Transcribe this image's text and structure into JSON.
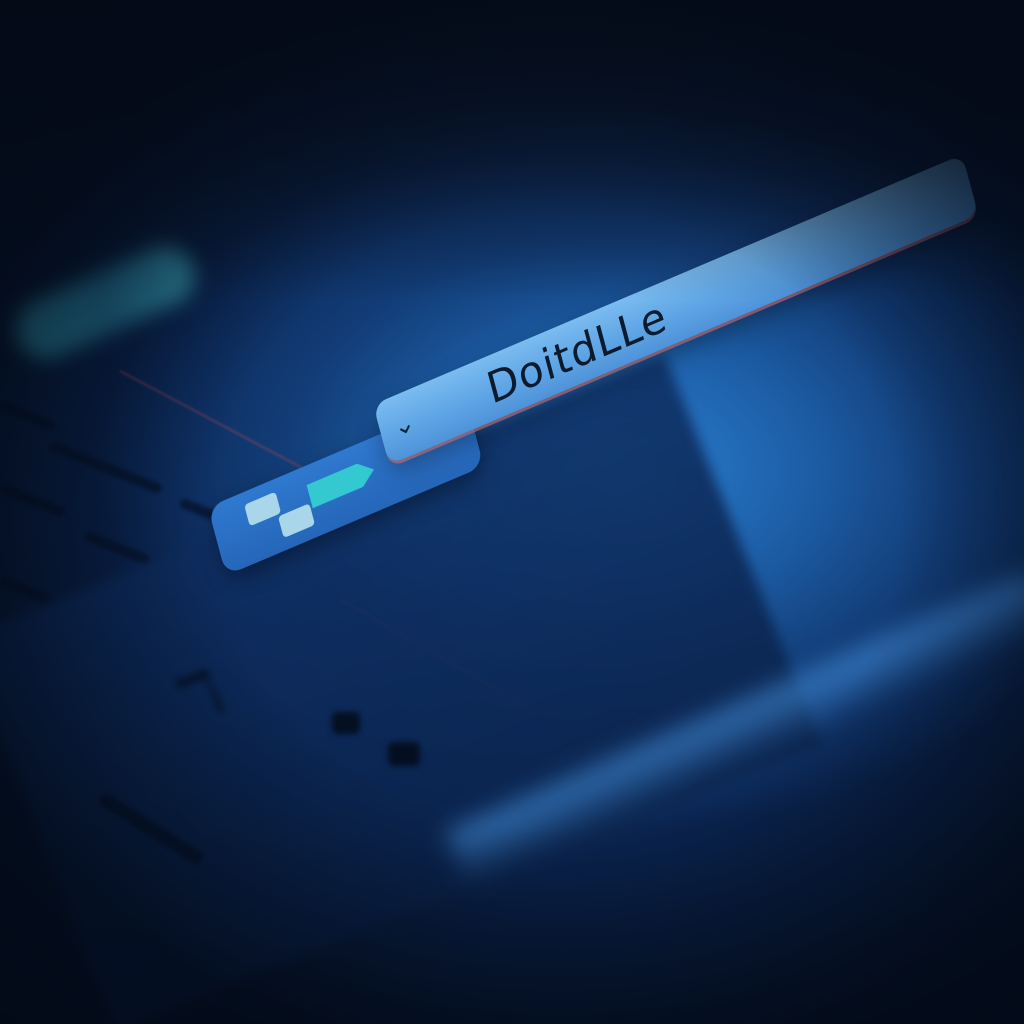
{
  "window": {
    "title": ""
  },
  "toolbar": {
    "back_label": "⌄",
    "address_text": "DoitdLLe"
  },
  "background": {
    "left_labels": [
      "",
      ""
    ],
    "glyph": "ℸ"
  },
  "colors": {
    "background_dark": "#06101f",
    "background_glow": "#2a7fd0",
    "toolbar_blue": "#2f79d0",
    "addressbar_blue": "#6aaee9",
    "accent_teal": "#34c8d0",
    "icon_square": "#a9d6e8",
    "addressbar_edge": "#d26e6e",
    "text_dark": "#0c1a2e"
  },
  "icons": {
    "app_icon": "app-logo-icon",
    "back": "chevron-icon",
    "glyph": "rotated-ui-glyph-icon"
  }
}
